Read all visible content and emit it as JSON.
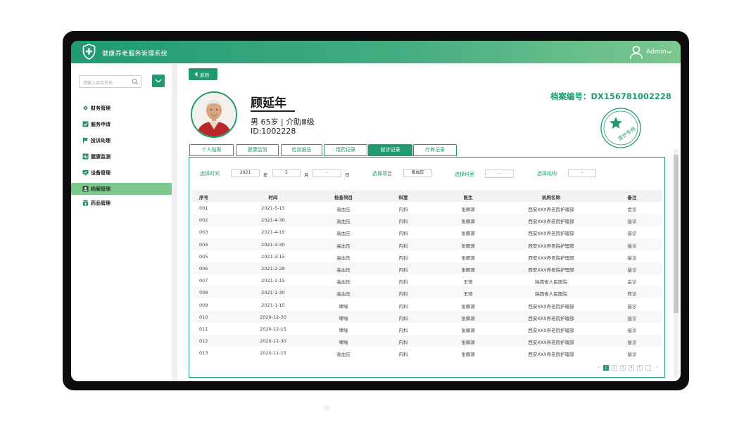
{
  "app": {
    "title": "健康养老服务管理系统"
  },
  "user": {
    "name": "Admin"
  },
  "sidebar": {
    "search_placeholder": "请输入项目名称",
    "items": [
      {
        "label": "财务管理",
        "icon": "finance-icon",
        "active": false
      },
      {
        "label": "服务申请",
        "icon": "checkbox-icon",
        "active": false
      },
      {
        "label": "投诉处理",
        "icon": "flag-icon",
        "active": false
      },
      {
        "label": "健康监测",
        "icon": "heart-monitor-icon",
        "active": false
      },
      {
        "label": "设备管理",
        "icon": "monitor-icon",
        "active": false
      },
      {
        "label": "档案管理",
        "icon": "profile-card-icon",
        "active": true
      },
      {
        "label": "药品管理",
        "icon": "medicine-icon",
        "active": false
      }
    ]
  },
  "main": {
    "back_label": "返回",
    "patient": {
      "name": "顾延年",
      "gender_age_level": "男  65岁 | 介助Ⅲ级",
      "id_line": "ID:1002228"
    },
    "file_number": "档案编号：DX156781002228",
    "stamp_text": "医护专用",
    "tabs": [
      {
        "label": "个人档案",
        "active": false
      },
      {
        "label": "健康监测",
        "active": false
      },
      {
        "label": "检测报告",
        "active": false
      },
      {
        "label": "用药记录",
        "active": false
      },
      {
        "label": "就诊记录",
        "active": true
      },
      {
        "label": "疗养记录",
        "active": false
      }
    ],
    "filters": {
      "time_label": "选择时间",
      "year_value": "2021",
      "year_unit": "年",
      "month_value": "5",
      "month_unit": "月",
      "day_value": "-",
      "day_unit": "日",
      "item_label": "选择项目",
      "item_value": "高血压",
      "dept_label": "选择科室",
      "dept_value": "-",
      "org_label": "选择机构",
      "org_value": "-"
    },
    "table": {
      "headers": [
        "序号",
        "时间",
        "检查项目",
        "科室",
        "医生",
        "机构名称",
        "备注"
      ],
      "rows": [
        [
          "001",
          "2021-5-15",
          "高血压",
          "内科",
          "张卿源",
          "西安XXX养老院护理部",
          "会诊"
        ],
        [
          "002",
          "2021-4-30",
          "高血压",
          "内科",
          "张卿源",
          "西安XXX养老院护理部",
          "接诊"
        ],
        [
          "003",
          "2021-4-15",
          "高血压",
          "内科",
          "张卿源",
          "西安XXX养老院护理部",
          "接诊"
        ],
        [
          "004",
          "2021-3-30",
          "高血压",
          "内科",
          "张卿源",
          "西安XXX养老院护理部",
          "接诊"
        ],
        [
          "005",
          "2021-3-15",
          "高血压",
          "内科",
          "张卿源",
          "西安XXX养老院护理部",
          "接诊"
        ],
        [
          "006",
          "2021-2-28",
          "高血压",
          "内科",
          "张卿源",
          "西安XXX养老院护理部",
          "接诊"
        ],
        [
          "007",
          "2021-2-15",
          "高血压",
          "内科",
          "王琦",
          "陕西省人民医院",
          "会诊"
        ],
        [
          "008",
          "2021-1-30",
          "高血压",
          "内科",
          "王琦",
          "陕西省人民医院",
          "转诊"
        ],
        [
          "009",
          "2021-1-15",
          "哮喘",
          "内科",
          "张卿源",
          "西安XXX养老院护理部",
          "接诊"
        ],
        [
          "010",
          "2020-12-30",
          "哮喘",
          "内科",
          "张卿源",
          "西安XXX养老院护理部",
          "接诊"
        ],
        [
          "011",
          "2020-12-15",
          "哮喘",
          "内科",
          "张卿源",
          "西安XXX养老院护理部",
          "接诊"
        ],
        [
          "012",
          "2020-11-30",
          "哮喘",
          "内科",
          "张卿源",
          "西安XXX养老院护理部",
          "接诊"
        ],
        [
          "013",
          "2020-11-15",
          "高血压",
          "内科",
          "张卿源",
          "西安XXX养老院护理部",
          "接诊"
        ]
      ]
    },
    "pagination": {
      "prev": "‹",
      "next": "›",
      "pages": [
        "1",
        "2",
        "3",
        "4",
        "5",
        "…"
      ],
      "current": "1"
    }
  },
  "colors": {
    "primary": "#1f9a72",
    "light": "#7cc88f"
  }
}
